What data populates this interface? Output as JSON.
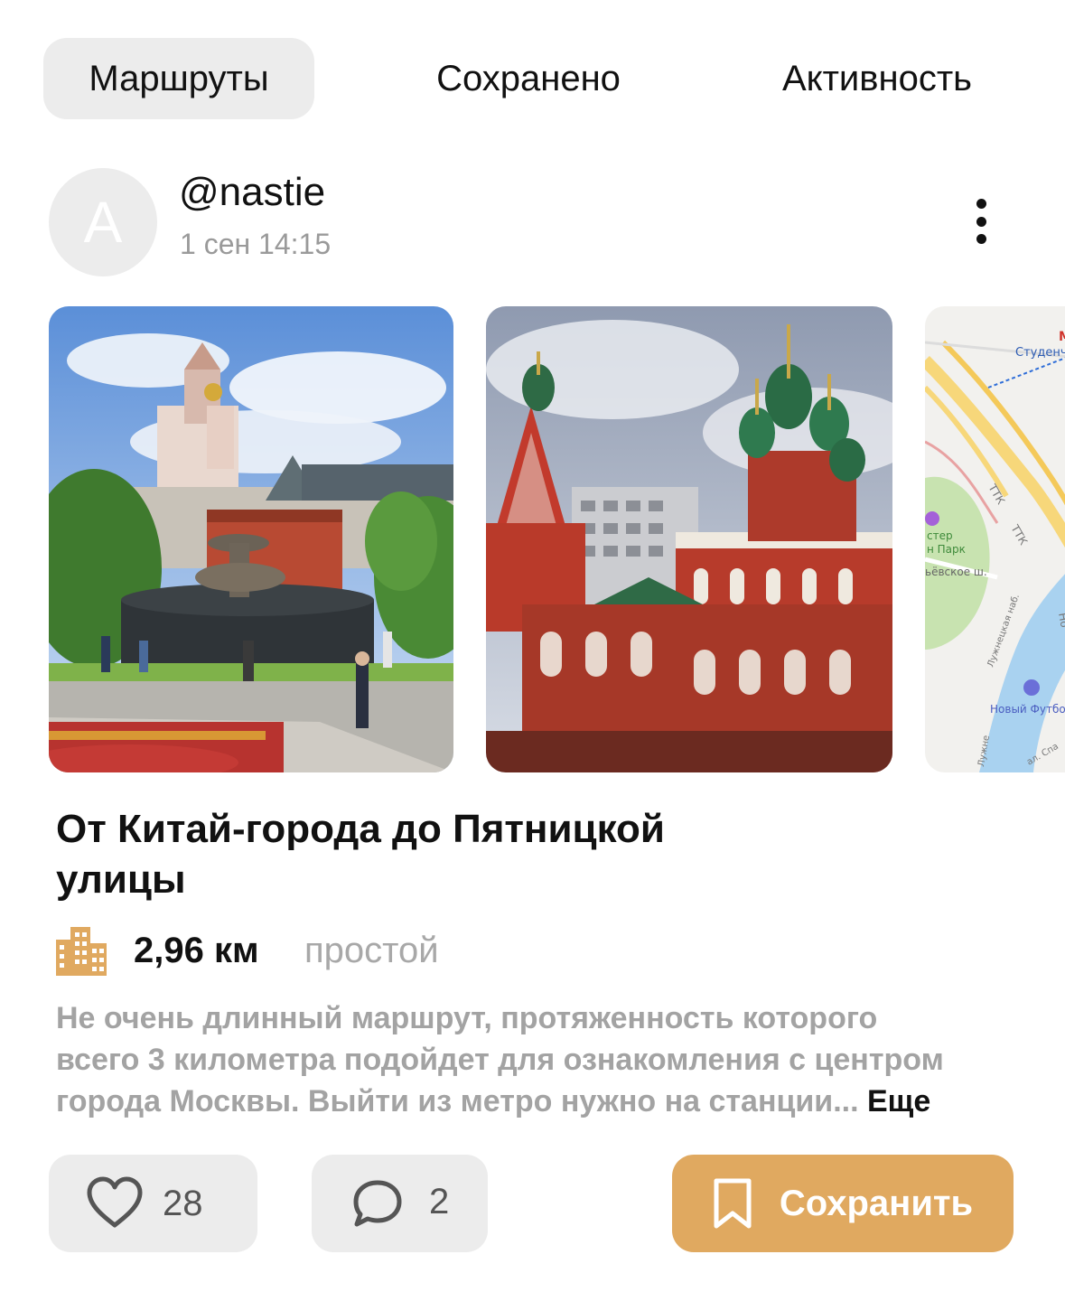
{
  "tabs": [
    {
      "label": "Маршруты",
      "active": true
    },
    {
      "label": "Сохранено",
      "active": false
    },
    {
      "label": "Активность",
      "active": false
    }
  ],
  "post": {
    "avatar_initial": "A",
    "username": "@nastie",
    "timestamp": "1 сен 14:15",
    "more_icon": "more-vertical-icon"
  },
  "gallery": {
    "photos": [
      {
        "subject": "square-fountain-photo"
      },
      {
        "subject": "church-green-domes-photo"
      },
      {
        "subject": "route-map-preview"
      }
    ],
    "map_labels": {
      "metro": "Студенч",
      "park": "стер\nн Парк",
      "street_1": "ьёвское ш.",
      "street_2": "Лужнецкая наб.",
      "ttk": "ТТК",
      "ttk2": "ТТК",
      "venue": "Новый Футбо",
      "side": "Лужне",
      "side2": "ал. Спа",
      "edge": "Но"
    }
  },
  "route": {
    "title": "От Китай-города до Пятницкой улицы",
    "title_line_1": "От Китай-города до Пятницкой",
    "title_line_2": "улицы",
    "type_icon": "city-building-icon",
    "distance": "2,96 км",
    "difficulty": "простой",
    "description_lines": [
      "Не очень длинный маршрут, протяженность которого",
      "всего 3 километра  подойдет для ознакомления с центром",
      "города Москвы. Выйти из метро нужно  на станции... "
    ],
    "more_label": "Еще"
  },
  "actions": {
    "likes_count": "28",
    "comments_count": "2",
    "save_label": "Сохранить"
  },
  "colors": {
    "accent": "#e0a960",
    "button_bg": "#ececec",
    "muted_text": "#a3a3a3"
  }
}
